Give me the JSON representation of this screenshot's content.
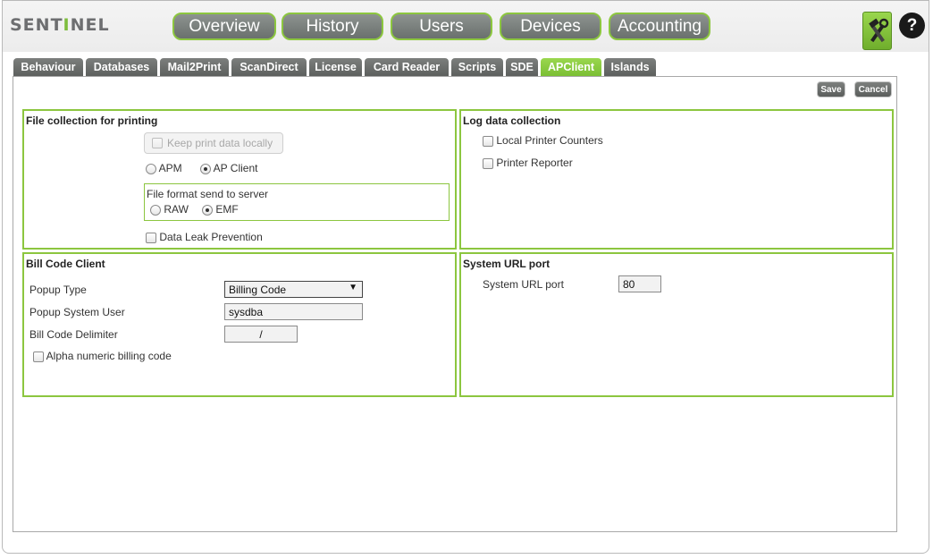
{
  "header": {
    "logo_prefix": "SENT",
    "logo_accent": "I",
    "logo_suffix": "NEL",
    "nav": [
      {
        "label": "Overview"
      },
      {
        "label": "History"
      },
      {
        "label": "Users"
      },
      {
        "label": "Devices"
      },
      {
        "label": "Accounting"
      }
    ],
    "tools_icon": "tools-icon",
    "help_label": "?"
  },
  "tabs": [
    {
      "label": "Behaviour"
    },
    {
      "label": "Databases"
    },
    {
      "label": "Mail2Print"
    },
    {
      "label": "ScanDirect"
    },
    {
      "label": "License"
    },
    {
      "label": "Card Reader"
    },
    {
      "label": "Scripts"
    },
    {
      "label": "SDE"
    },
    {
      "label": "APClient",
      "active": true
    },
    {
      "label": "Islands"
    }
  ],
  "toolbar": {
    "save_label": "Save",
    "cancel_label": "Cancel"
  },
  "file_collection": {
    "title": "File collection for printing",
    "keep_local_label": "Keep print data locally",
    "apm_label": "APM",
    "apclient_label": "AP Client",
    "format_title": "File format send to server",
    "raw_label": "RAW",
    "emf_label": "EMF",
    "dlp_label": "Data Leak Prevention"
  },
  "log_data": {
    "title": "Log data collection",
    "local_counters_label": "Local Printer Counters",
    "reporter_label": "Printer Reporter"
  },
  "bill_code": {
    "title": "Bill Code Client",
    "popup_type_label": "Popup Type",
    "popup_type_value": "Billing Code",
    "popup_user_label": "Popup System User",
    "popup_user_value": "sysdba",
    "delimiter_label": "Bill Code Delimiter",
    "delimiter_value": "/",
    "alpha_label": "Alpha numeric billing code"
  },
  "url_port": {
    "title": "System URL port",
    "label": "System URL port",
    "value": "80"
  },
  "colors": {
    "accent": "#8cc63f",
    "button_gray": "#6a706d"
  }
}
